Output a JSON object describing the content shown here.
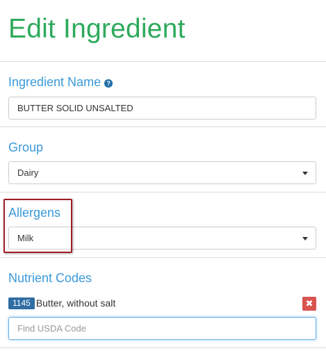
{
  "page": {
    "title": "Edit Ingredient"
  },
  "ingredient_name": {
    "label": "Ingredient Name",
    "help_icon": "question-circle-icon",
    "value": "BUTTER SOLID UNSALTED"
  },
  "group": {
    "label": "Group",
    "selected": "Dairy",
    "icon": "caret-down-icon"
  },
  "allergens": {
    "label": "Allergens",
    "selected": "Milk",
    "icon": "caret-down-icon",
    "highlight_color": "#a01c24"
  },
  "nutrient_codes": {
    "label": "Nutrient Codes",
    "items": [
      {
        "code": "1145",
        "description": "Butter, without salt"
      }
    ],
    "remove_icon": "times-icon",
    "search_placeholder": "Find USDA Code"
  },
  "colors": {
    "title": "#2eaa5c",
    "label": "#3a9ad9",
    "badge": "#2f6da3",
    "remove": "#d9534f"
  }
}
